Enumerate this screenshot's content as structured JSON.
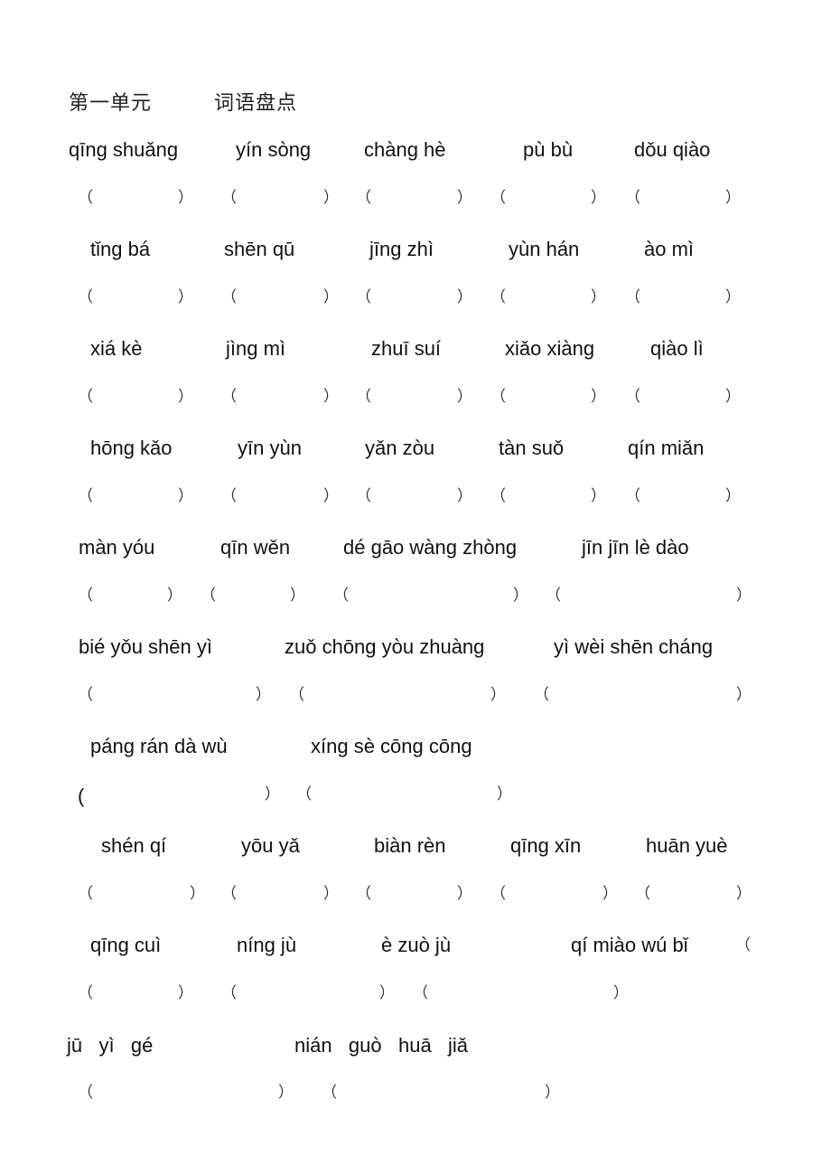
{
  "header": {
    "unit": "第一单元",
    "section": "词语盘点"
  },
  "rows": [
    {
      "words": [
        {
          "pinyin": "qīng shuǎng"
        },
        {
          "pinyin": "yín sòng"
        },
        {
          "pinyin": "chàng hè"
        },
        {
          "pinyin": "pù bù"
        },
        {
          "pinyin": "dǒu qiào"
        }
      ]
    },
    {
      "words": [
        {
          "pinyin": "tǐng bá"
        },
        {
          "pinyin": "shēn qū"
        },
        {
          "pinyin": "jīng zhì"
        },
        {
          "pinyin": "yùn hán"
        },
        {
          "pinyin": "ào mì"
        }
      ]
    },
    {
      "words": [
        {
          "pinyin": "xiá kè"
        },
        {
          "pinyin": "jìng mì"
        },
        {
          "pinyin": "zhuī suí"
        },
        {
          "pinyin": "xiǎo xiàng"
        },
        {
          "pinyin": "qiào lì"
        }
      ]
    },
    {
      "words": [
        {
          "pinyin": "hōng kǎo"
        },
        {
          "pinyin": "yīn yùn"
        },
        {
          "pinyin": "yǎn zòu"
        },
        {
          "pinyin": "tàn suǒ"
        },
        {
          "pinyin": "qín miǎn"
        }
      ]
    },
    {
      "words": [
        {
          "pinyin": "màn yóu"
        },
        {
          "pinyin": "qīn wěn"
        },
        {
          "pinyin": "dé gāo wàng zhòng"
        },
        {
          "pinyin": "jīn jīn lè dào"
        }
      ]
    },
    {
      "words": [
        {
          "pinyin": "bié yǒu shēn yì"
        },
        {
          "pinyin": "zuǒ chōng yòu zhuàng"
        },
        {
          "pinyin": "yì wèi shēn cháng"
        }
      ]
    },
    {
      "words": [
        {
          "pinyin": "páng rán dà wù"
        },
        {
          "pinyin": "xíng sè cōng cōng"
        }
      ]
    },
    {
      "words": [
        {
          "pinyin": "shén qí"
        },
        {
          "pinyin": "yōu yǎ"
        },
        {
          "pinyin": "biàn rèn"
        },
        {
          "pinyin": "qīng xīn"
        },
        {
          "pinyin": "huān yuè"
        }
      ]
    },
    {
      "words": [
        {
          "pinyin": "qīng cuì"
        },
        {
          "pinyin": "níng jù"
        },
        {
          "pinyin": "è zuò jù"
        },
        {
          "pinyin": "qí miào wú bǐ"
        }
      ],
      "stray_open_paren": "（"
    },
    {
      "words": [
        {
          "pinyin": "jū   yì   gé"
        },
        {
          "pinyin": "nián   guò   huā   jiǎ"
        }
      ]
    }
  ],
  "paren": {
    "open": "（",
    "close": "）",
    "open_ascii": "("
  }
}
